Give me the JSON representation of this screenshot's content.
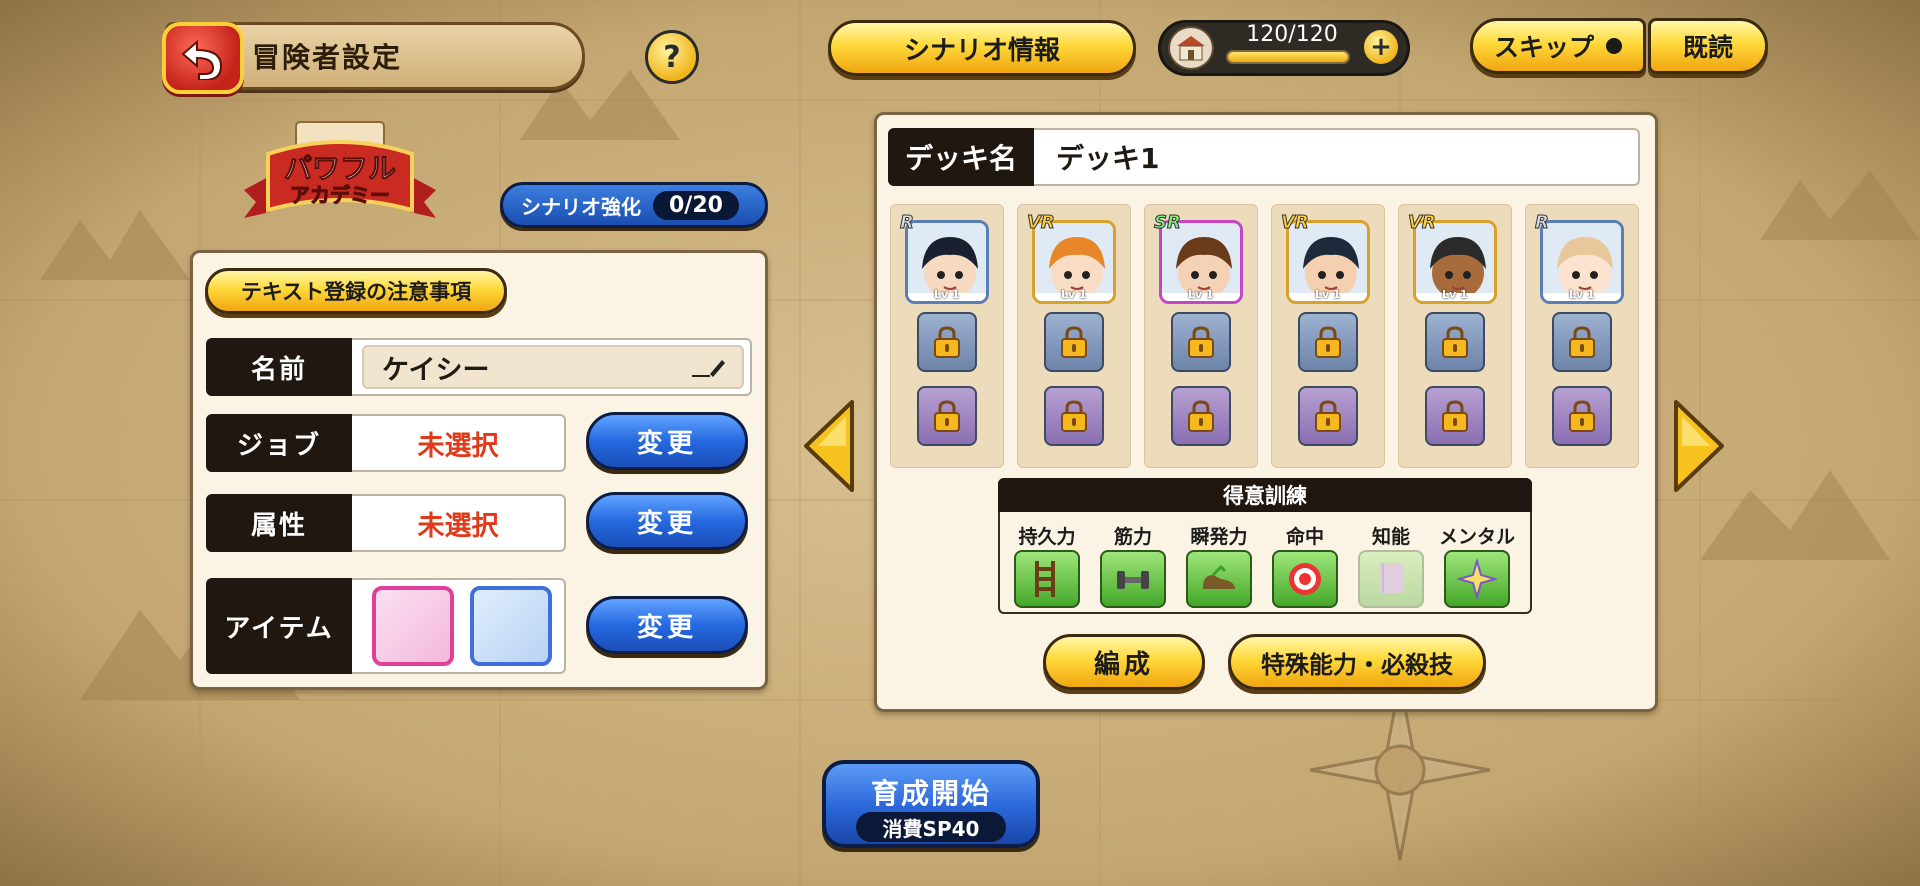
{
  "header": {
    "title": "冒険者設定",
    "help_label": "?",
    "scenario_info_label": "シナリオ情報",
    "stamina": {
      "current": 120,
      "max": 120,
      "text": "120/120",
      "fill_ratio": 1.0
    },
    "plus_label": "+",
    "skip_label": "スキップ",
    "read_label": "既読"
  },
  "logo": {
    "line1": "パワフル",
    "line2": "アカデミー"
  },
  "scenario_strength": {
    "label": "シナリオ強化",
    "value": "0/20"
  },
  "left_panel": {
    "notice_label": "テキスト登録の注意事項",
    "rows": [
      {
        "label": "名前",
        "value": "ケイシー"
      },
      {
        "label": "ジョブ",
        "value": "未選択",
        "button": "変更"
      },
      {
        "label": "属性",
        "value": "未選択",
        "button": "変更"
      },
      {
        "label": "アイテム",
        "button": "変更"
      }
    ]
  },
  "deck": {
    "label": "デッキ名",
    "name": "デッキ1",
    "cards": [
      {
        "rarity": "R",
        "level": "Lv 1",
        "frame": "#5a7fb5",
        "hair": "#1b2030",
        "skin": "#f7d9c2"
      },
      {
        "rarity": "VR",
        "level": "Lv 1",
        "frame": "#d8a22a",
        "hair": "#e8862a",
        "skin": "#f9dcc4"
      },
      {
        "rarity": "SR",
        "level": "Lv 1",
        "frame": "#c445c8",
        "hair": "#6a3b1a",
        "skin": "#f4d2b6"
      },
      {
        "rarity": "VR",
        "level": "Lv 1",
        "frame": "#d8a22a",
        "hair": "#1e2a3c",
        "skin": "#f4d0b0"
      },
      {
        "rarity": "VR",
        "level": "Lv 1",
        "frame": "#d8a22a",
        "hair": "#2a2a2a",
        "skin": "#a86b3c"
      },
      {
        "rarity": "R",
        "level": "Lv 1",
        "frame": "#5a7fb5",
        "hair": "#e8c89a",
        "skin": "#fbe3cf"
      }
    ],
    "training_header": "得意訓練",
    "training": [
      {
        "label": "持久力",
        "icon": "ladder-icon",
        "active": true
      },
      {
        "label": "筋力",
        "icon": "dumbbell-icon",
        "active": true
      },
      {
        "label": "瞬発力",
        "icon": "shoe-icon",
        "active": true
      },
      {
        "label": "命中",
        "icon": "target-icon",
        "active": true
      },
      {
        "label": "知能",
        "icon": "book-icon",
        "active": false
      },
      {
        "label": "メンタル",
        "icon": "spark-icon",
        "active": true
      }
    ],
    "form_label": "編成",
    "special_label": "特殊能力・必殺技"
  },
  "start": {
    "label": "育成開始",
    "cost": "消費SP40"
  },
  "colors": {
    "accent_yellow": "#ffd93a",
    "accent_blue": "#2569e0",
    "unselected_red": "#e03a1a",
    "panel": "#fbf3e3"
  }
}
